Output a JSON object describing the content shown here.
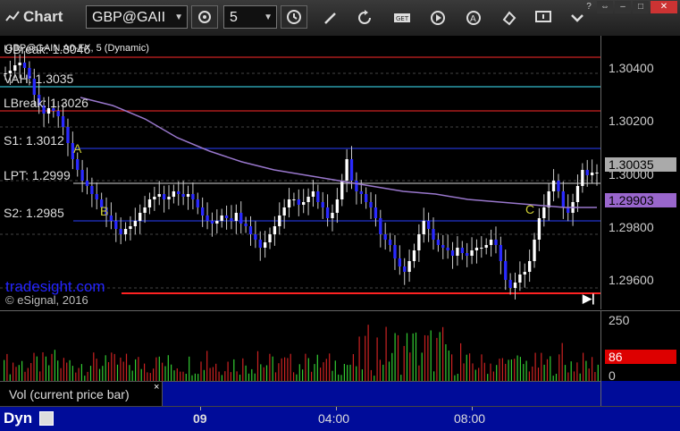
{
  "app": {
    "title": "Chart"
  },
  "toolbar": {
    "symbol": "GBP@GAII",
    "interval": "5"
  },
  "chart": {
    "legend_title": "GBP@GAIN.A0-FX, 5 (Dynamic)",
    "watermark": "tradesight.com",
    "copyright": "© eSignal, 2016",
    "levels": [
      {
        "label": "UBreak: 1.3046",
        "value": 1.3046,
        "color": "#cc2222"
      },
      {
        "label": "VAH: 1.3035",
        "value": 1.3035,
        "color": "#33bbcc"
      },
      {
        "label": "LBreak: 1.3026",
        "value": 1.3026,
        "color": "#cc2222"
      },
      {
        "label": "S1: 1.3012",
        "value": 1.3012,
        "color": "#2233cc"
      },
      {
        "label": "LPT: 1.2999",
        "value": 1.2999,
        "color": "#aaaaaa"
      },
      {
        "label": "S2: 1.2985",
        "value": 1.2985,
        "color": "#2233cc"
      }
    ],
    "bottom_line_color": "#ff2222",
    "markers": [
      "A",
      "B",
      "C"
    ],
    "price_axis_labels": [
      "1.30400",
      "1.30200",
      "1.30000",
      "1.29800",
      "1.29600"
    ],
    "last_price": {
      "label": "1.30035",
      "color": "#aaaaaa"
    },
    "ma_price": {
      "label": "1.29903",
      "color": "#9966cc"
    }
  },
  "volume": {
    "legend": "Vol (current price bar)",
    "close_glyph": "×",
    "axis_labels": [
      "250",
      "0"
    ],
    "last_value": {
      "label": "86",
      "color": "#dd0000"
    }
  },
  "time_axis": {
    "mode_label": "Dyn",
    "labels": [
      "09",
      "04:00",
      "08:00"
    ]
  },
  "chart_data": {
    "type": "candlestick",
    "y_range": [
      1.2952,
      1.3054
    ],
    "ma_series": [
      1.3031,
      1.3028,
      1.3023,
      1.3016,
      1.3011,
      1.3007,
      1.3004,
      1.3002,
      1.3,
      1.2998,
      1.2996,
      1.2995,
      1.2993,
      1.2992,
      1.2991,
      1.299,
      1.299
    ]
  }
}
